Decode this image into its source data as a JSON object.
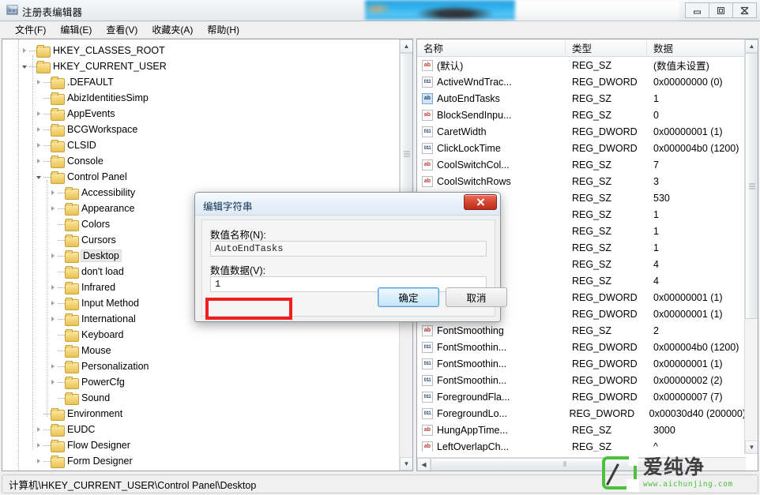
{
  "window": {
    "title": "注册表编辑器",
    "icon": "registry-editor-icon",
    "controls": {
      "minimize": "—",
      "maximize": "❐",
      "close": "✕"
    }
  },
  "menu": {
    "items": [
      {
        "label": "文件(F)"
      },
      {
        "label": "编辑(E)"
      },
      {
        "label": "查看(V)"
      },
      {
        "label": "收藏夹(A)"
      },
      {
        "label": "帮助(H)"
      }
    ]
  },
  "tree": {
    "nodes": [
      {
        "label": "HKEY_CLASSES_ROOT",
        "depth": 1,
        "state": "collapsed",
        "selected": false
      },
      {
        "label": "HKEY_CURRENT_USER",
        "depth": 1,
        "state": "expanded",
        "selected": false
      },
      {
        "label": ".DEFAULT",
        "depth": 2,
        "state": "collapsed",
        "selected": false
      },
      {
        "label": "AbizIdentitiesSimp",
        "depth": 2,
        "state": "leaf",
        "selected": false
      },
      {
        "label": "AppEvents",
        "depth": 2,
        "state": "collapsed",
        "selected": false
      },
      {
        "label": "BCGWorkspace",
        "depth": 2,
        "state": "collapsed",
        "selected": false
      },
      {
        "label": "CLSID",
        "depth": 2,
        "state": "collapsed",
        "selected": false
      },
      {
        "label": "Console",
        "depth": 2,
        "state": "collapsed",
        "selected": false
      },
      {
        "label": "Control Panel",
        "depth": 2,
        "state": "expanded",
        "selected": false
      },
      {
        "label": "Accessibility",
        "depth": 3,
        "state": "collapsed",
        "selected": false
      },
      {
        "label": "Appearance",
        "depth": 3,
        "state": "collapsed",
        "selected": false
      },
      {
        "label": "Colors",
        "depth": 3,
        "state": "leaf",
        "selected": false
      },
      {
        "label": "Cursors",
        "depth": 3,
        "state": "leaf",
        "selected": false
      },
      {
        "label": "Desktop",
        "depth": 3,
        "state": "collapsed",
        "selected": true
      },
      {
        "label": "don't load",
        "depth": 3,
        "state": "leaf",
        "selected": false
      },
      {
        "label": "Infrared",
        "depth": 3,
        "state": "collapsed",
        "selected": false
      },
      {
        "label": "Input Method",
        "depth": 3,
        "state": "collapsed",
        "selected": false
      },
      {
        "label": "International",
        "depth": 3,
        "state": "collapsed",
        "selected": false
      },
      {
        "label": "Keyboard",
        "depth": 3,
        "state": "leaf",
        "selected": false
      },
      {
        "label": "Mouse",
        "depth": 3,
        "state": "leaf",
        "selected": false
      },
      {
        "label": "Personalization",
        "depth": 3,
        "state": "collapsed",
        "selected": false
      },
      {
        "label": "PowerCfg",
        "depth": 3,
        "state": "collapsed",
        "selected": false
      },
      {
        "label": "Sound",
        "depth": 3,
        "state": "leaf",
        "selected": false
      },
      {
        "label": "Environment",
        "depth": 2,
        "state": "leaf",
        "selected": false
      },
      {
        "label": "EUDC",
        "depth": 2,
        "state": "collapsed",
        "selected": false
      },
      {
        "label": "Flow Designer",
        "depth": 2,
        "state": "collapsed",
        "selected": false
      },
      {
        "label": "Form Designer",
        "depth": 2,
        "state": "collapsed",
        "selected": false
      }
    ]
  },
  "list": {
    "columns": [
      "名称",
      "类型",
      "数据"
    ],
    "rows": [
      {
        "name": "(默认)",
        "icon": "sz",
        "type": "REG_SZ",
        "data": "(数值未设置)",
        "selected": false
      },
      {
        "name": "ActiveWndTrac...",
        "icon": "dword",
        "type": "REG_DWORD",
        "data": "0x00000000 (0)",
        "selected": false
      },
      {
        "name": "AutoEndTasks",
        "icon": "sz",
        "type": "REG_SZ",
        "data": "1",
        "selected": true
      },
      {
        "name": "BlockSendInpu...",
        "icon": "sz",
        "type": "REG_SZ",
        "data": "0",
        "selected": false
      },
      {
        "name": "CaretWidth",
        "icon": "dword",
        "type": "REG_DWORD",
        "data": "0x00000001 (1)",
        "selected": false
      },
      {
        "name": "ClickLockTime",
        "icon": "dword",
        "type": "REG_DWORD",
        "data": "0x000004b0 (1200)",
        "selected": false
      },
      {
        "name": "CoolSwitchCol...",
        "icon": "sz",
        "type": "REG_SZ",
        "data": "7",
        "selected": false
      },
      {
        "name": "CoolSwitchRows",
        "icon": "sz",
        "type": "REG_SZ",
        "data": "3",
        "selected": false
      },
      {
        "name": "",
        "icon": "sz",
        "type": "REG_SZ",
        "data": "530",
        "selected": false
      },
      {
        "name": "",
        "icon": "sz",
        "type": "REG_SZ",
        "data": "1",
        "selected": false
      },
      {
        "name": "",
        "icon": "sz",
        "type": "REG_SZ",
        "data": "1",
        "selected": false
      },
      {
        "name": "",
        "icon": "sz",
        "type": "REG_SZ",
        "data": "1",
        "selected": false
      },
      {
        "name": "",
        "icon": "sz",
        "type": "REG_SZ",
        "data": "4",
        "selected": false
      },
      {
        "name": "",
        "icon": "sz",
        "type": "REG_SZ",
        "data": "4",
        "selected": false
      },
      {
        "name": "",
        "icon": "dword",
        "type": "REG_DWORD",
        "data": "0x00000001 (1)",
        "selected": false
      },
      {
        "name": "",
        "icon": "dword",
        "type": "REG_DWORD",
        "data": "0x00000001 (1)",
        "selected": false
      },
      {
        "name": "FontSmoothing",
        "icon": "sz",
        "type": "REG_SZ",
        "data": "2",
        "selected": false
      },
      {
        "name": "FontSmoothin...",
        "icon": "dword",
        "type": "REG_DWORD",
        "data": "0x000004b0 (1200)",
        "selected": false
      },
      {
        "name": "FontSmoothin...",
        "icon": "dword",
        "type": "REG_DWORD",
        "data": "0x00000001 (1)",
        "selected": false
      },
      {
        "name": "FontSmoothin...",
        "icon": "dword",
        "type": "REG_DWORD",
        "data": "0x00000002 (2)",
        "selected": false
      },
      {
        "name": "ForegroundFla...",
        "icon": "dword",
        "type": "REG_DWORD",
        "data": "0x00000007 (7)",
        "selected": false
      },
      {
        "name": "ForegroundLo...",
        "icon": "dword",
        "type": "REG_DWORD",
        "data": "0x00030d40 (200000)",
        "selected": false
      },
      {
        "name": "HungAppTime...",
        "icon": "sz",
        "type": "REG_SZ",
        "data": "3000",
        "selected": false
      },
      {
        "name": "LeftOverlapCh...",
        "icon": "sz",
        "type": "REG_SZ",
        "data": "^",
        "selected": false
      }
    ]
  },
  "dialog": {
    "title": "编辑字符串",
    "close_label": "✕",
    "name_label": "数值名称(N):",
    "name_value": "AutoEndTasks",
    "data_label": "数值数据(V):",
    "data_value": "1",
    "ok_label": "确定",
    "cancel_label": "取消",
    "highlight_color": "#f01f1f"
  },
  "statusbar": {
    "path": "计算机\\HKEY_CURRENT_USER\\Control Panel\\Desktop"
  },
  "watermark": {
    "brand": "爱纯净",
    "url": "www.aichunjing.com",
    "accent": "#4cc23c"
  }
}
